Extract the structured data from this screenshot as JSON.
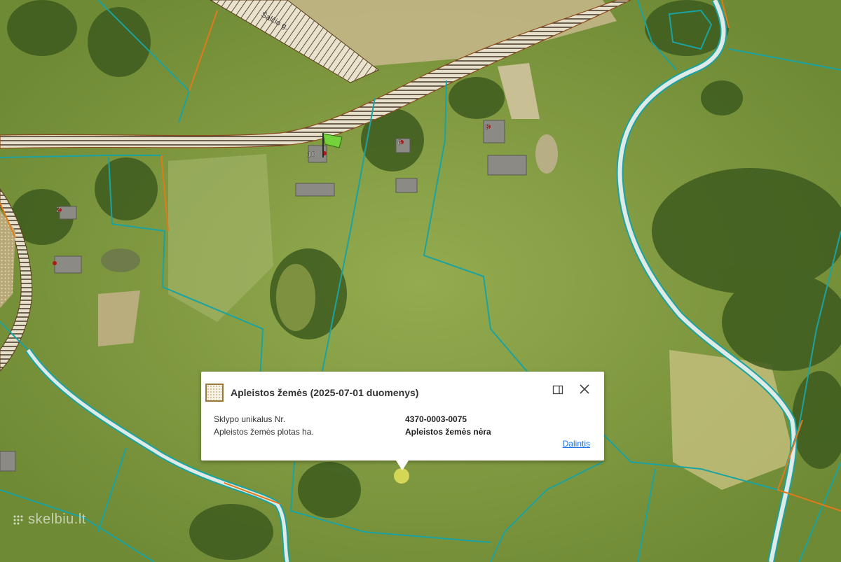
{
  "map": {
    "road_label": "Šalčio g.",
    "house_numbers": [
      "10",
      "2",
      "6",
      "8"
    ],
    "colors": {
      "parcel_border": "#1aa3a0",
      "boundary_orange": "#e07a1a",
      "road_hatch": "#3a2a1a",
      "stream": "#dfe9e6"
    }
  },
  "popup": {
    "title": "Apleistos žemės (2025-07-01 duomenys)",
    "rows": [
      {
        "label": "Sklypo unikalus Nr.",
        "value": "4370-0003-0075"
      },
      {
        "label": "Apleistos žemės plotas ha.",
        "value": "Apleistos žemės nėra"
      }
    ],
    "share_label": "Dalintis",
    "icons": {
      "layer": "abandoned-land-layer-icon",
      "window": "window-icon",
      "close": "close-icon"
    }
  },
  "watermark": "skelbiu.lt"
}
